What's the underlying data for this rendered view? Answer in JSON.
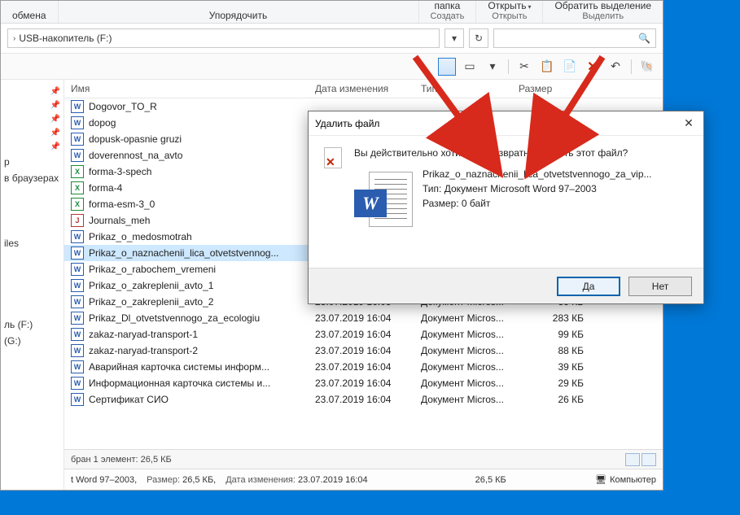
{
  "ribbon": {
    "groups": [
      {
        "line1": "обмена",
        "label": ""
      },
      {
        "line1": "Упорядочить",
        "label": ""
      },
      {
        "line1": "папка",
        "label": "Создать"
      },
      {
        "line1": "Открыть",
        "label": "Открыть"
      },
      {
        "line1": "Обратить выделение",
        "label": "Выделить"
      }
    ]
  },
  "addr": {
    "path": "USB-накопитель (F:)",
    "search_placeholder": ""
  },
  "columns": {
    "name": "Имя",
    "date": "Дата изменения",
    "type": "Тип",
    "size": "Размер"
  },
  "files": [
    {
      "icon": "doc",
      "name": "Dogovor_TO_R",
      "date": "",
      "type": "",
      "size": ""
    },
    {
      "icon": "doc",
      "name": "dopog",
      "date": "",
      "type": "",
      "size": ""
    },
    {
      "icon": "doc",
      "name": "dopusk-opasnie gruzi",
      "date": "",
      "type": "",
      "size": ""
    },
    {
      "icon": "doc",
      "name": "doverennost_na_avto",
      "date": "",
      "type": "",
      "size": ""
    },
    {
      "icon": "xls",
      "name": "forma-3-spech",
      "date": "",
      "type": "",
      "size": ""
    },
    {
      "icon": "xls",
      "name": "forma-4",
      "date": "",
      "type": "",
      "size": ""
    },
    {
      "icon": "xls",
      "name": "forma-esm-3_0",
      "date": "",
      "type": "",
      "size": ""
    },
    {
      "icon": "pdf",
      "name": "Journals_meh",
      "date": "",
      "type": "",
      "size": ""
    },
    {
      "icon": "doc",
      "name": "Prikaz_o_medosmotrah",
      "date": "",
      "type": "",
      "size": ""
    },
    {
      "icon": "doc",
      "name": "Prikaz_o_naznachenii_lica_otvetstvennog...",
      "date": "",
      "type": "",
      "size": "",
      "selected": true
    },
    {
      "icon": "doc",
      "name": "Prikaz_o_rabochem_vremeni",
      "date": "",
      "type": "",
      "size": ""
    },
    {
      "icon": "doc",
      "name": "Prikaz_o_zakreplenii_avto_1",
      "date": "",
      "type": "",
      "size": ""
    },
    {
      "icon": "doc",
      "name": "Prikaz_o_zakreplenii_avto_2",
      "date": "23.07.2019 16:03",
      "type": "Документ Micros...",
      "size": "38 КБ"
    },
    {
      "icon": "doc",
      "name": "Prikaz_Dl_otvetstvennogo_za_ecologiu",
      "date": "23.07.2019 16:04",
      "type": "Документ Micros...",
      "size": "283 КБ"
    },
    {
      "icon": "doc",
      "name": "zakaz-naryad-transport-1",
      "date": "23.07.2019 16:04",
      "type": "Документ Micros...",
      "size": "99 КБ"
    },
    {
      "icon": "doc",
      "name": "zakaz-naryad-transport-2",
      "date": "23.07.2019 16:04",
      "type": "Документ Micros...",
      "size": "88 КБ"
    },
    {
      "icon": "doc",
      "name": "Аварийная карточка системы информ...",
      "date": "23.07.2019 16:04",
      "type": "Документ Micros...",
      "size": "39 КБ"
    },
    {
      "icon": "doc",
      "name": "Информационная карточка системы и...",
      "date": "23.07.2019 16:04",
      "type": "Документ Micros...",
      "size": "29 КБ"
    },
    {
      "icon": "doc",
      "name": "Сертификат СИО",
      "date": "23.07.2019 16:04",
      "type": "Документ Micros...",
      "size": "26 КБ"
    }
  ],
  "sidebar": {
    "items": [
      "р",
      "в браузерах",
      "",
      "iles",
      "",
      "ль (F:)",
      "(G:)"
    ]
  },
  "status": {
    "sel": "бран 1 элемент: 26,5 КБ"
  },
  "details": {
    "type_label": "t Word 97–2003,",
    "size_label": "Размер:",
    "size": "26,5 КБ,",
    "date_label": "Дата изменения:",
    "date": "23.07.2019 16:04",
    "sel_size": "26,5 КБ",
    "computer": "Компьютер"
  },
  "dialog": {
    "title": "Удалить файл",
    "question": "Вы действительно хотите безвозвратно удалить этот файл?",
    "filename": "Prikaz_o_naznachenii_lica_otvetstvennogo_za_vip...",
    "type_label": "Тип:",
    "type": "Документ Microsoft Word 97–2003",
    "size_label": "Размер:",
    "size": "0 байт",
    "yes": "Да",
    "no": "Нет"
  }
}
